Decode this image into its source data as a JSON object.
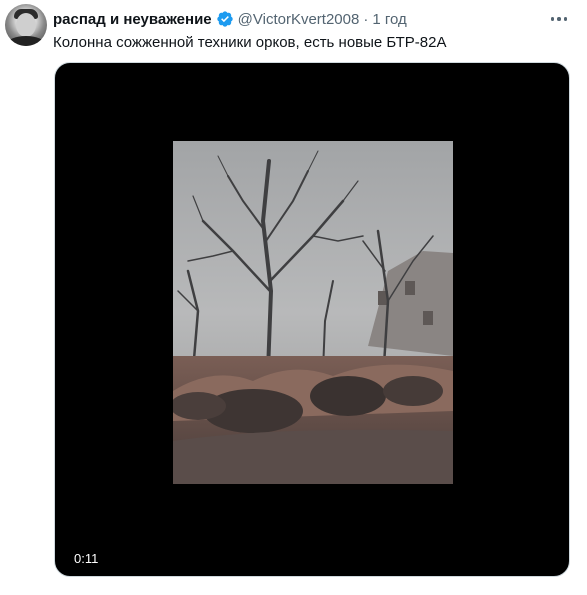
{
  "tweet": {
    "author_name": "распад и неуважение",
    "handle": "@VictorKvert2008",
    "separator": "·",
    "time": "1 год",
    "text": "Колонна сожженной техники орков, есть новые БТР-82А",
    "verified_icon": "verified-badge-icon",
    "more_icon": "more-options-icon"
  },
  "media": {
    "duration": "0:11"
  },
  "colors": {
    "accent": "#1d9bf0",
    "secondary_text": "#536471",
    "primary_text": "#0f1419"
  }
}
